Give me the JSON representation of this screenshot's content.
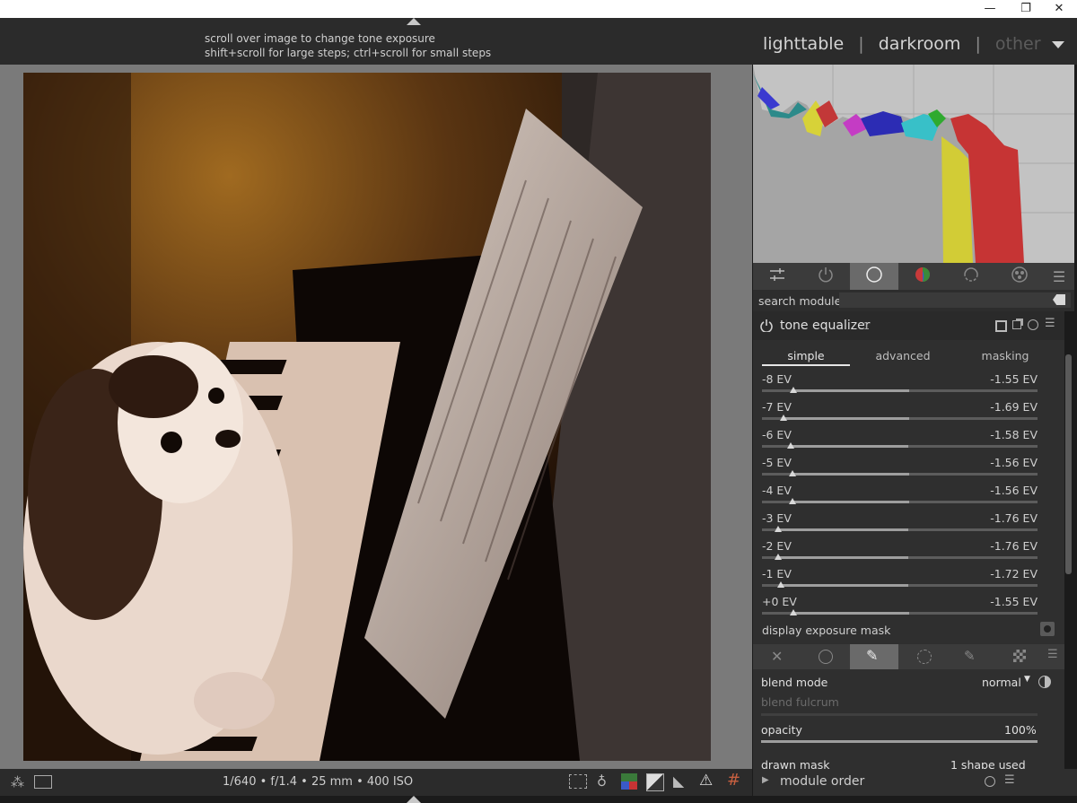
{
  "window": {
    "minimize": "—",
    "restore": "❐",
    "close": "✕"
  },
  "hint": {
    "line1": "scroll over image to change tone exposure",
    "line2": "shift+scroll for large steps; ctrl+scroll for small steps"
  },
  "views": {
    "lighttable": "lighttable",
    "darkroom": "darkroom",
    "other": "other",
    "separator": "|"
  },
  "search": {
    "label": "search module",
    "value": ""
  },
  "module": {
    "name": "tone equalizer",
    "instance": "1",
    "tabs": [
      "simple",
      "advanced",
      "masking"
    ],
    "active_tab": "simple",
    "sliders": [
      {
        "label": "-8 EV",
        "value": "-1.55 EV"
      },
      {
        "label": "-7 EV",
        "value": "-1.69 EV"
      },
      {
        "label": "-6 EV",
        "value": "-1.58 EV"
      },
      {
        "label": "-5 EV",
        "value": "-1.56 EV"
      },
      {
        "label": "-4 EV",
        "value": "-1.56 EV"
      },
      {
        "label": "-3 EV",
        "value": "-1.76 EV"
      },
      {
        "label": "-2 EV",
        "value": "-1.76 EV"
      },
      {
        "label": "-1 EV",
        "value": "-1.72 EV"
      },
      {
        "label": "+0 EV",
        "value": "-1.55 EV"
      }
    ],
    "display_mask": "display exposure mask"
  },
  "blend": {
    "mode_label": "blend mode",
    "mode_value": "normal",
    "fulcrum_label": "blend fulcrum",
    "opacity_label": "opacity",
    "opacity_value": "100%",
    "drawn_mask_label": "drawn mask",
    "drawn_mask_value": "1 shape used"
  },
  "bottom": {
    "exif": "1/640 • f/1.4 • 25 mm • 400 ISO",
    "module_order": "module order"
  },
  "colors": {
    "accent": "#e8e8e8",
    "panel": "#2f2f2f",
    "histogram_bg": "#c3c3c3"
  }
}
